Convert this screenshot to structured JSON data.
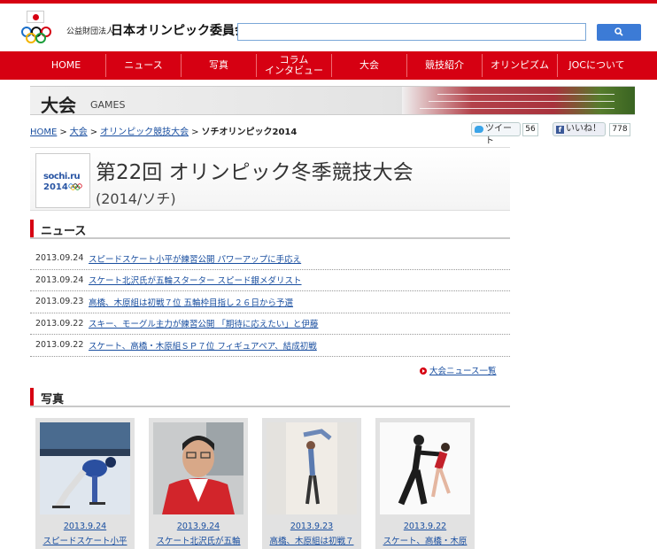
{
  "header": {
    "org_small": "公益財団法人",
    "org_name": "日本オリンピック委員会",
    "search": {
      "value": "",
      "placeholder": ""
    }
  },
  "nav": {
    "items": [
      {
        "label": "HOME"
      },
      {
        "label": "ニュース"
      },
      {
        "label": "写真"
      },
      {
        "label": "コラム\nインタビュー"
      },
      {
        "label": "大会"
      },
      {
        "label": "競技紹介"
      },
      {
        "label": "オリンピズム"
      },
      {
        "label": "JOCについて"
      }
    ]
  },
  "banner": {
    "title": "大会",
    "subtitle": "GAMES"
  },
  "breadcrumb": {
    "items": [
      "HOME",
      "大会",
      "オリンピック競技大会"
    ],
    "current": "ソチオリンピック2014"
  },
  "social": {
    "tweet_label": "ツイート",
    "tweet_count": "56",
    "like_label": "いいね！",
    "like_count": "778"
  },
  "event": {
    "logo_line1": "sochi.ru",
    "logo_line2": "2014",
    "title": "第22回 オリンピック冬季競技大会",
    "subtitle": "(2014/ソチ)"
  },
  "news": {
    "heading": "ニュース",
    "items": [
      {
        "date": "2013.09.24",
        "title": "スピードスケート小平が練習公開 パワーアップに手応え"
      },
      {
        "date": "2013.09.24",
        "title": "スケート北沢氏が五輪スターター スピード銀メダリスト"
      },
      {
        "date": "2013.09.23",
        "title": "高橋、木原組は初戦７位 五輪枠目指し２６日から予選"
      },
      {
        "date": "2013.09.22",
        "title": "スキー、モーグル主力が練習公開 「期待に応えたい」と伊藤"
      },
      {
        "date": "2013.09.22",
        "title": "スケート、高橋・木原組ＳＰ７位 フィギュアペア、結成初戦"
      }
    ],
    "more_label": "大会ニュース一覧"
  },
  "photos": {
    "heading": "写真",
    "items": [
      {
        "date": "2013.9.24",
        "caption": "スピードスケート小平"
      },
      {
        "date": "2013.9.24",
        "caption": "スケート北沢氏が五輪"
      },
      {
        "date": "2013.9.23",
        "caption": "高橋、木原組は初戦７"
      },
      {
        "date": "2013.9.22",
        "caption": "スケート、高橋・木原"
      }
    ]
  },
  "colors": {
    "brand_red": "#d60012",
    "link_blue": "#1a4fa0",
    "search_blue": "#3c7bd6"
  }
}
